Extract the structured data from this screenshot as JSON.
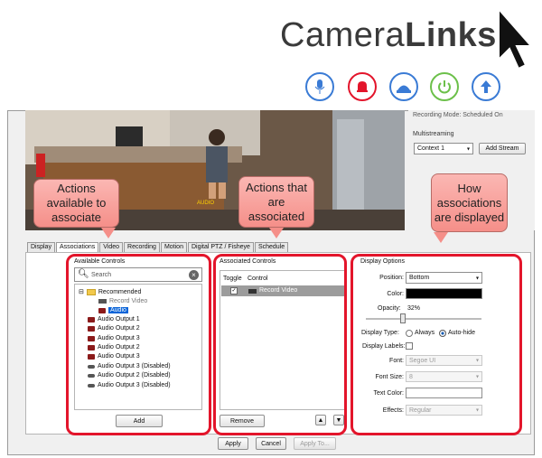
{
  "brand": {
    "light": "Camera",
    "bold": "Links"
  },
  "header_icons": [
    {
      "name": "microphone-icon",
      "color": "#3a7bd5"
    },
    {
      "name": "alarm-bell-icon",
      "color": "#e3152b"
    },
    {
      "name": "ptz-camera-icon",
      "color": "#3a7bd5"
    },
    {
      "name": "power-icon",
      "color": "#6cc04a"
    },
    {
      "name": "upload-arrow-icon",
      "color": "#3a7bd5"
    }
  ],
  "video": {
    "overlay_text": "AUDIO"
  },
  "right_panel": {
    "recording_mode": "Recording Mode:   Scheduled On",
    "multistreaming_label": "Multistreaming",
    "context_value": "Context 1",
    "add_stream_label": "Add Stream"
  },
  "tabs": [
    "Display",
    "Associations",
    "Video",
    "Recording",
    "Motion",
    "Digital PTZ / Fisheye",
    "Schedule"
  ],
  "available": {
    "title": "Available Controls",
    "search_placeholder": "Search",
    "folder": "Recommended",
    "record_video": "Record Video",
    "audio": "Audio",
    "items": [
      "Audio Output 1",
      "Audio Output 2",
      "Audio Output 3",
      "Audio Output 2",
      "Audio Output 3",
      "Audio Output 3 (Disabled)",
      "Audio Output 2 (Disabled)",
      "Audio Output 3 (Disabled)"
    ],
    "add_label": "Add"
  },
  "associated": {
    "title": "Associated Controls",
    "col_toggle": "Toggle",
    "col_control": "Control",
    "row_control": "Record Video",
    "remove_label": "Remove"
  },
  "display_options": {
    "title": "Display Options",
    "position_label": "Position:",
    "position_value": "Bottom",
    "color_label": "Color:",
    "color_value": "#000000",
    "opacity_label": "Opacity:",
    "opacity_value": "32%",
    "opacity_fraction": 0.32,
    "display_type_label": "Display Type:",
    "always_label": "Always",
    "autohide_label": "Auto-hide",
    "display_labels_label": "Display Labels:",
    "font_label": "Font:",
    "font_value": "Segoe UI",
    "font_size_label": "Font Size:",
    "font_size_value": "8",
    "text_color_label": "Text Color:",
    "effects_label": "Effects:",
    "effects_value": "Regular"
  },
  "footer": {
    "apply": "Apply",
    "cancel": "Cancel",
    "apply_to": "Apply To..."
  },
  "callouts": {
    "left": "Actions available to associate",
    "middle": "Actions that are associated",
    "right": "How associations are displayed"
  }
}
